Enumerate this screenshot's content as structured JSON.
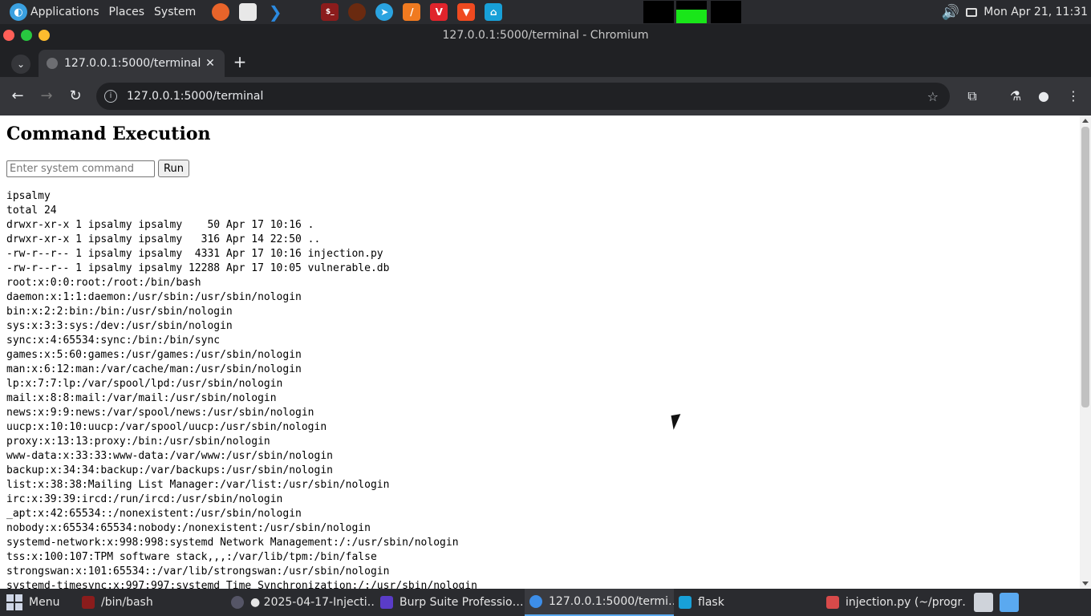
{
  "top_panel": {
    "menus": [
      "Applications",
      "Places",
      "System"
    ],
    "clock": "Mon Apr 21, 11:31"
  },
  "window": {
    "title": "127.0.0.1:5000/terminal - Chromium"
  },
  "browser": {
    "tab_title": "127.0.0.1:5000/terminal",
    "url": "127.0.0.1:5000/terminal"
  },
  "page": {
    "heading": "Command Execution",
    "input_placeholder": "Enter system command",
    "run_label": "Run",
    "output_lines": [
      "ipsalmy",
      "total 24",
      "drwxr-xr-x 1 ipsalmy ipsalmy    50 Apr 17 10:16 .",
      "drwxr-xr-x 1 ipsalmy ipsalmy   316 Apr 14 22:50 ..",
      "-rw-r--r-- 1 ipsalmy ipsalmy  4331 Apr 17 10:16 injection.py",
      "-rw-r--r-- 1 ipsalmy ipsalmy 12288 Apr 17 10:05 vulnerable.db",
      "root:x:0:0:root:/root:/bin/bash",
      "daemon:x:1:1:daemon:/usr/sbin:/usr/sbin/nologin",
      "bin:x:2:2:bin:/bin:/usr/sbin/nologin",
      "sys:x:3:3:sys:/dev:/usr/sbin/nologin",
      "sync:x:4:65534:sync:/bin:/bin/sync",
      "games:x:5:60:games:/usr/games:/usr/sbin/nologin",
      "man:x:6:12:man:/var/cache/man:/usr/sbin/nologin",
      "lp:x:7:7:lp:/var/spool/lpd:/usr/sbin/nologin",
      "mail:x:8:8:mail:/var/mail:/usr/sbin/nologin",
      "news:x:9:9:news:/var/spool/news:/usr/sbin/nologin",
      "uucp:x:10:10:uucp:/var/spool/uucp:/usr/sbin/nologin",
      "proxy:x:13:13:proxy:/bin:/usr/sbin/nologin",
      "www-data:x:33:33:www-data:/var/www:/usr/sbin/nologin",
      "backup:x:34:34:backup:/var/backups:/usr/sbin/nologin",
      "list:x:38:38:Mailing List Manager:/var/list:/usr/sbin/nologin",
      "irc:x:39:39:ircd:/run/ircd:/usr/sbin/nologin",
      "_apt:x:42:65534::/nonexistent:/usr/sbin/nologin",
      "nobody:x:65534:65534:nobody:/nonexistent:/usr/sbin/nologin",
      "systemd-network:x:998:998:systemd Network Management:/:/usr/sbin/nologin",
      "tss:x:100:107:TPM software stack,,,:/var/lib/tpm:/bin/false",
      "strongswan:x:101:65534::/var/lib/strongswan:/usr/sbin/nologin",
      "systemd-timesync:x:997:997:systemd Time Synchronization:/:/usr/sbin/nologin"
    ]
  },
  "taskbar": {
    "menu_label": "Menu",
    "tasks": [
      "/bin/bash",
      "● 2025-04-17-Injecti…",
      "Burp Suite Professio…",
      "127.0.0.1:5000/termi…",
      "flask",
      "injection.py (~/progr…"
    ]
  },
  "colors": {
    "panel_bg": "#2a2b2f",
    "browser_dark": "#202124",
    "toolbar": "#35363a",
    "active_task_accent": "#5aa9f0"
  }
}
